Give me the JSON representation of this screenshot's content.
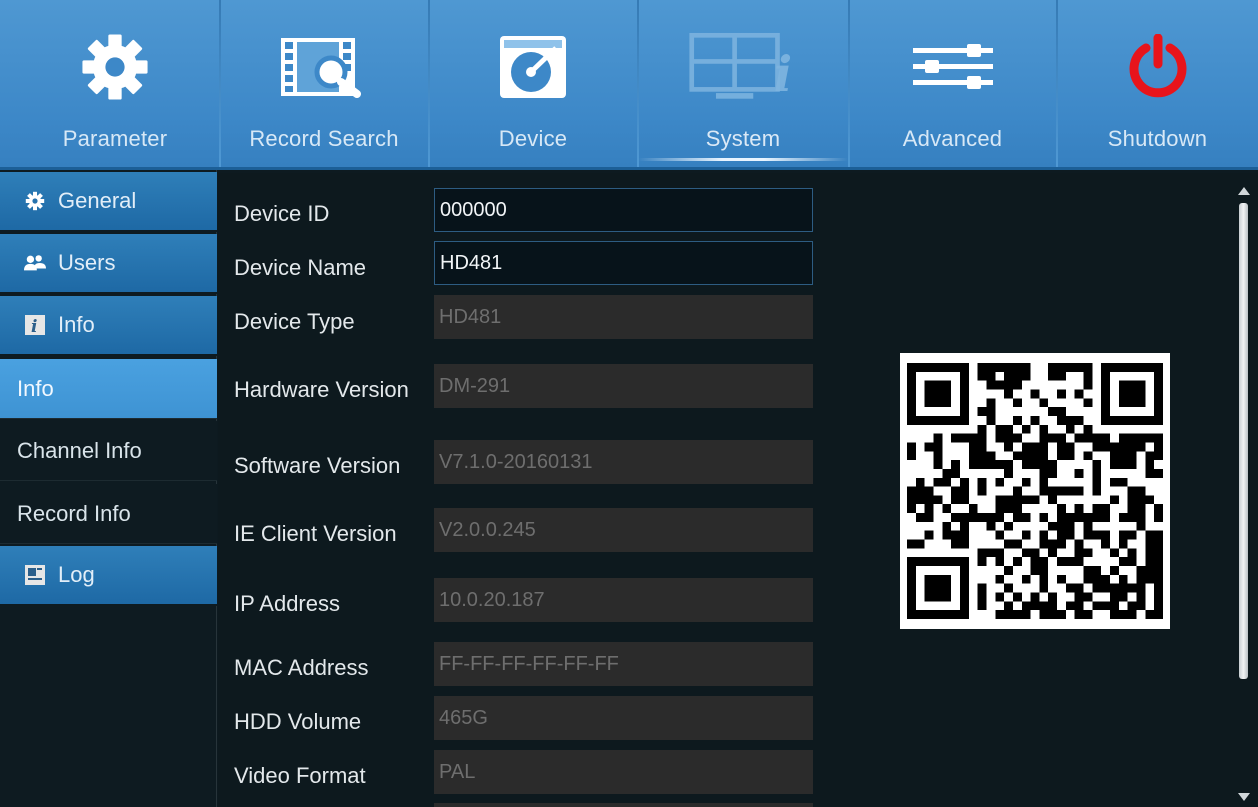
{
  "topnav": {
    "items": [
      {
        "label": "Parameter",
        "icon": "gear-icon"
      },
      {
        "label": "Record Search",
        "icon": "record-search-icon"
      },
      {
        "label": "Device",
        "icon": "device-disk-icon"
      },
      {
        "label": "System",
        "icon": "system-info-icon",
        "active": true
      },
      {
        "label": "Advanced",
        "icon": "sliders-icon"
      },
      {
        "label": "Shutdown",
        "icon": "power-icon"
      }
    ]
  },
  "sidebar": {
    "items": [
      {
        "label": "General",
        "type": "category",
        "icon": "gear-icon"
      },
      {
        "label": "Users",
        "type": "category",
        "icon": "users-icon"
      },
      {
        "label": "Info",
        "type": "category",
        "icon": "info-icon"
      },
      {
        "label": "Info",
        "type": "sub",
        "selected": true
      },
      {
        "label": "Channel Info",
        "type": "sub"
      },
      {
        "label": "Record Info",
        "type": "sub"
      },
      {
        "label": "Log",
        "type": "category",
        "icon": "log-icon"
      }
    ]
  },
  "info": {
    "rows": [
      {
        "label": "Device ID",
        "value": "000000",
        "editable": true
      },
      {
        "label": "Device Name",
        "value": "HD481",
        "editable": true
      },
      {
        "label": "Device Type",
        "value": "HD481",
        "editable": false
      },
      {
        "label": "Hardware Version",
        "value": "DM-291",
        "editable": false
      },
      {
        "label": "Software Version",
        "value": "V7.1.0-20160131",
        "editable": false
      },
      {
        "label": "IE Client Version",
        "value": "V2.0.0.245",
        "editable": false
      },
      {
        "label": "IP Address",
        "value": "10.0.20.187",
        "editable": false
      },
      {
        "label": "MAC Address",
        "value": "FF-FF-FF-FF-FF-FF",
        "editable": false
      },
      {
        "label": "HDD Volume",
        "value": "465G",
        "editable": false
      },
      {
        "label": "Video Format",
        "value": "PAL",
        "editable": false
      }
    ]
  },
  "colors": {
    "nav_bg": "#3d88c8",
    "category_bg": "#1e69a5",
    "selected_bg": "#3e93d3",
    "power_red": "#e8141b"
  }
}
